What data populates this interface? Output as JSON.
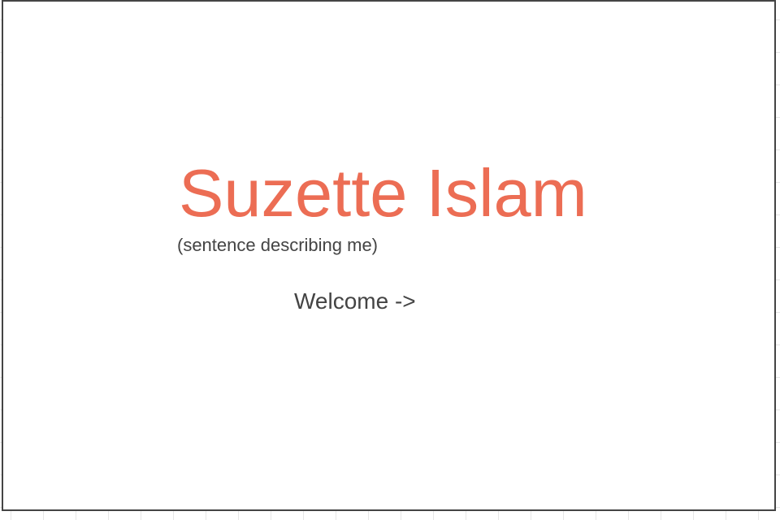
{
  "hero": {
    "name": "Suzette Islam",
    "tagline": "(sentence describing me)",
    "welcome_label": "Welcome ->"
  },
  "colors": {
    "accent": "#ec6d54",
    "text": "#444444",
    "frame_border": "#444444",
    "grid_line": "#e6e6e6",
    "background": "#ffffff"
  }
}
